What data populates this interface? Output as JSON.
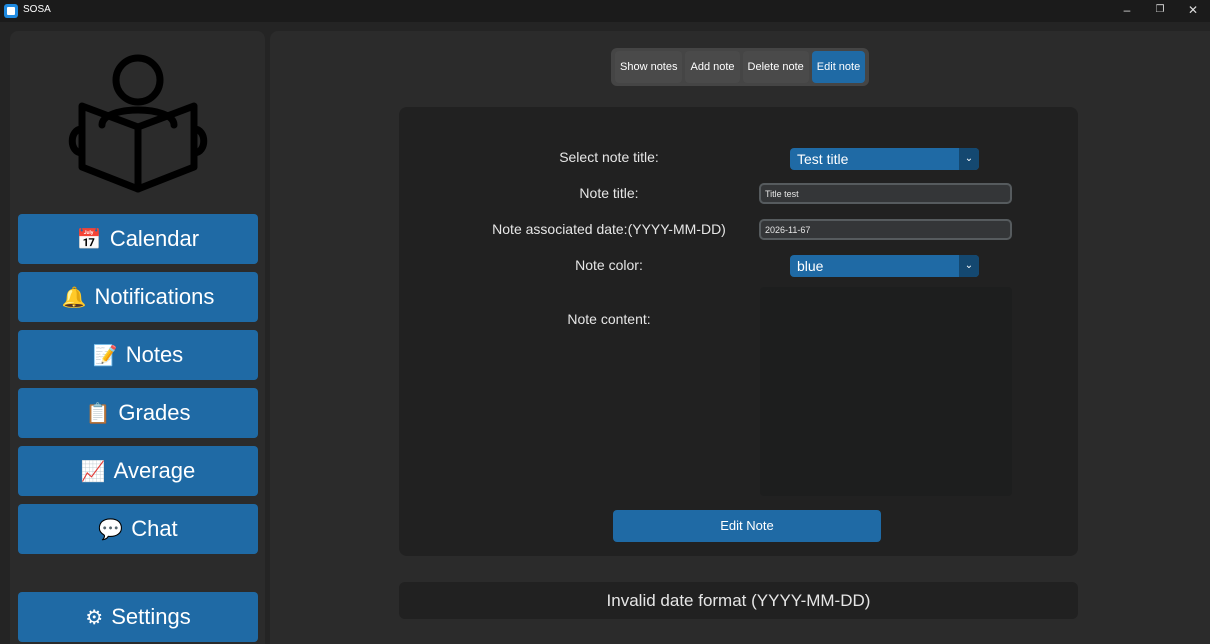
{
  "window": {
    "title": "SOSA",
    "controls": [
      "–",
      "❐",
      "✕"
    ]
  },
  "sidebar": {
    "logo_icon": "reading-person-icon",
    "items": [
      {
        "label": "Calendar",
        "icon": "📅"
      },
      {
        "label": "Notifications",
        "icon": "🔔"
      },
      {
        "label": "Notes",
        "icon": "📝"
      },
      {
        "label": "Grades",
        "icon": "📋"
      },
      {
        "label": "Average",
        "icon": "📈"
      },
      {
        "label": "Chat",
        "icon": "💬"
      }
    ],
    "settings": {
      "label": "Settings",
      "icon": "⚙"
    }
  },
  "tabs": [
    "Show notes",
    "Add note",
    "Delete note",
    "Edit note"
  ],
  "form": {
    "select_label": "Select note title:",
    "select_value": "Test title",
    "title_label": "Note title:",
    "title_value": "Title test",
    "date_label": "Note associated date:(YYYY-MM-DD)",
    "date_value": "2026-11-67",
    "color_label": "Note color:",
    "color_value": "blue",
    "content_label": "Note content:",
    "content_value": "",
    "submit_label": "Edit Note"
  },
  "status_message": "Invalid date format (YYYY-MM-DD)",
  "colors": {
    "accent": "#1f6aa5",
    "accent_dark": "#144870",
    "panel": "#212121",
    "background": "#242424"
  }
}
